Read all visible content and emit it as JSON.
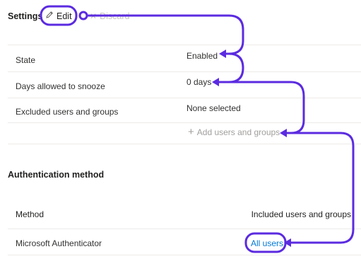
{
  "toolbar": {
    "title": "Settings",
    "edit_label": "Edit",
    "discard_label": "Discard",
    "edit_icon": "pencil-icon",
    "discard_icon": "close-icon"
  },
  "settings_rows": [
    {
      "label": "State",
      "value": "Enabled"
    },
    {
      "label": "Days allowed to snooze",
      "value": "0 days"
    },
    {
      "label": "Excluded users and groups",
      "value": "None selected"
    }
  ],
  "add_users": {
    "label": "Add users and groups",
    "icon": "plus-icon"
  },
  "auth_section": {
    "title": "Authentication method",
    "columns": [
      "Method",
      "Included users and groups"
    ],
    "rows": [
      {
        "method": "Microsoft Authenticator",
        "included": "All users"
      }
    ]
  },
  "colors": {
    "annotation": "#5b2be0",
    "link": "#0078d4",
    "divider": "#edebe9"
  }
}
